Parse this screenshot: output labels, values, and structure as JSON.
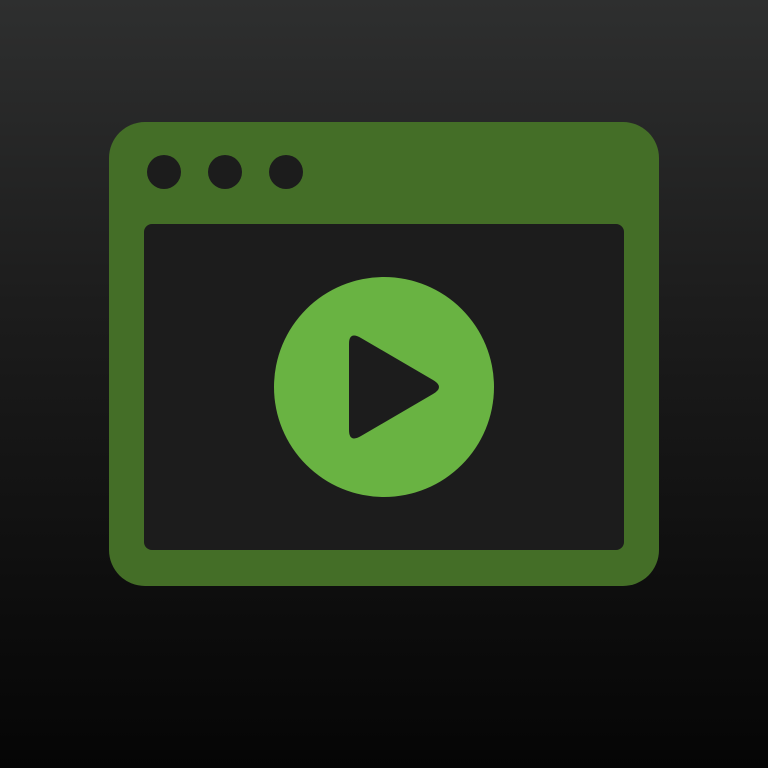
{
  "icon": {
    "name": "video-player-window-icon",
    "window_frame_color": "#446e27",
    "window_content_color": "#1c1c1c",
    "play_button_color": "#69b342",
    "play_glyph_color": "#1c1c1c",
    "window_controls": [
      "dot",
      "dot",
      "dot"
    ]
  },
  "colors": {
    "background_top": "#2e2f2f",
    "background_bottom": "#050505"
  }
}
